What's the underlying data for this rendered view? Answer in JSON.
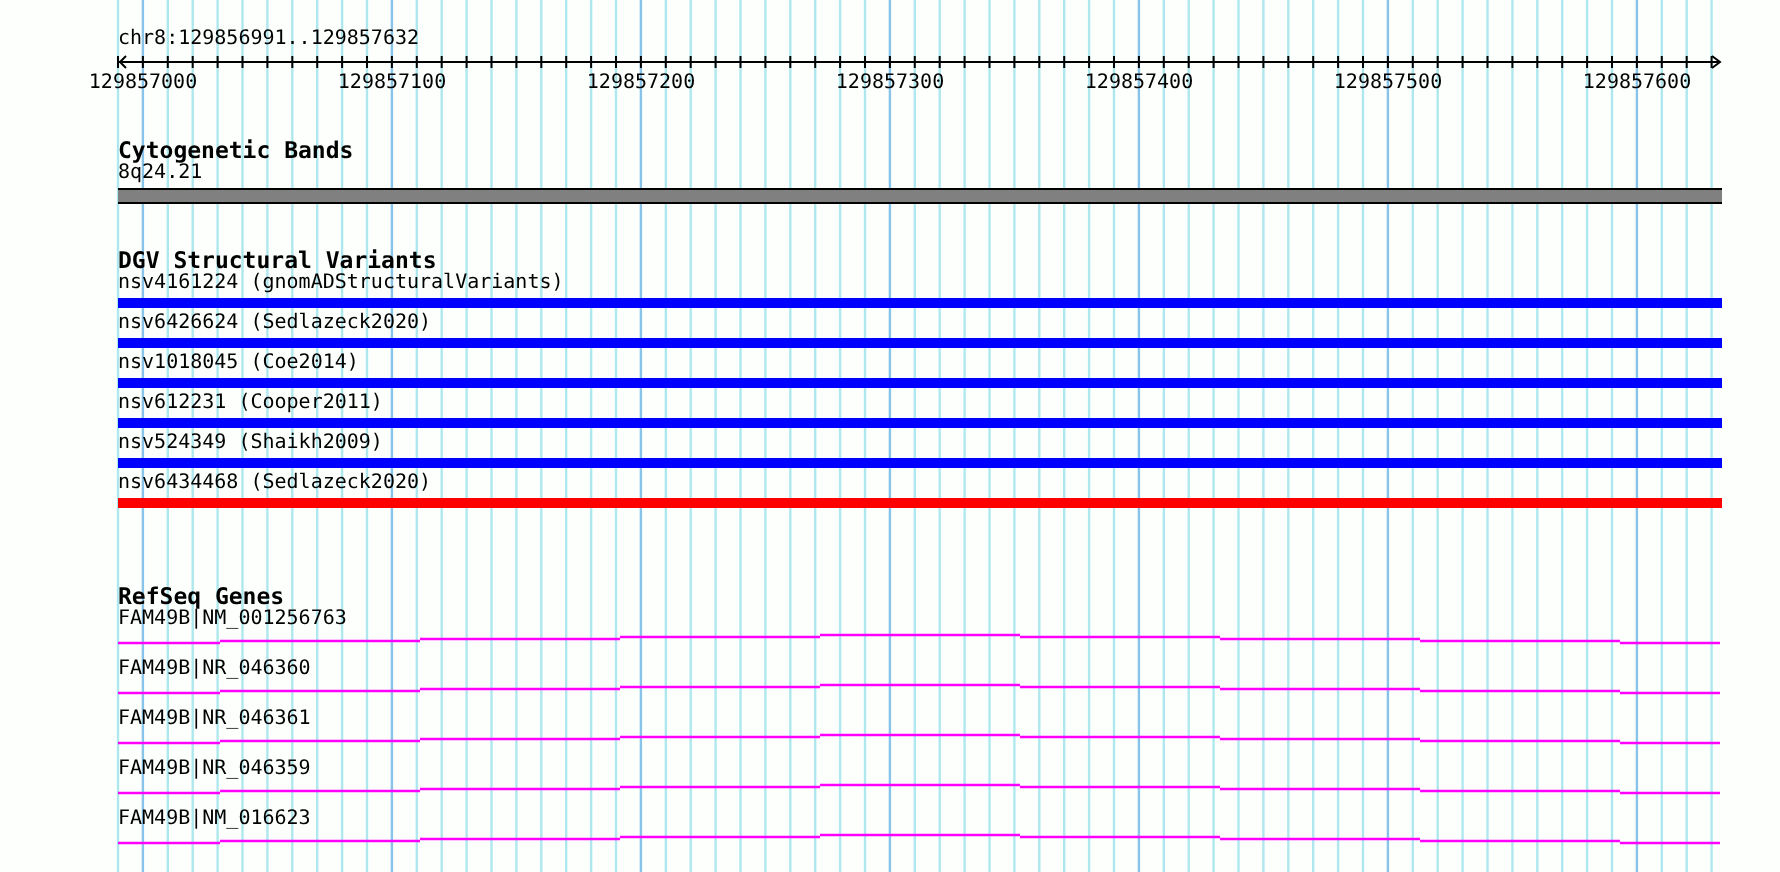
{
  "location": "chr8:129856991..129857632",
  "ruler": {
    "ticks": [
      "129857000",
      "129857100",
      "129857200",
      "129857300",
      "129857400",
      "129857500",
      "129857600"
    ]
  },
  "tracks": [
    {
      "kind": "cytoband",
      "title": "Cytogenetic Bands",
      "features": [
        {
          "label": "8q24.21"
        }
      ]
    },
    {
      "kind": "variants",
      "title": "DGV Structural Variants",
      "features": [
        {
          "label": "nsv4161224 (gnomADStructuralVariants)",
          "color": "#0000ff"
        },
        {
          "label": "nsv6426624 (Sedlazeck2020)",
          "color": "#0000ff"
        },
        {
          "label": "nsv1018045 (Coe2014)",
          "color": "#0000ff"
        },
        {
          "label": "nsv612231 (Cooper2011)",
          "color": "#0000ff"
        },
        {
          "label": "nsv524349 (Shaikh2009)",
          "color": "#0000ff"
        },
        {
          "label": "nsv6434468 (Sedlazeck2020)",
          "color": "#ff0000"
        }
      ]
    },
    {
      "kind": "genes",
      "title": "RefSeq Genes",
      "features": [
        {
          "label": "FAM49B|NM_001256763"
        },
        {
          "label": "FAM49B|NR_046360"
        },
        {
          "label": "FAM49B|NR_046361"
        },
        {
          "label": "FAM49B|NR_046359"
        },
        {
          "label": "FAM49B|NM_016623"
        }
      ]
    }
  ]
}
